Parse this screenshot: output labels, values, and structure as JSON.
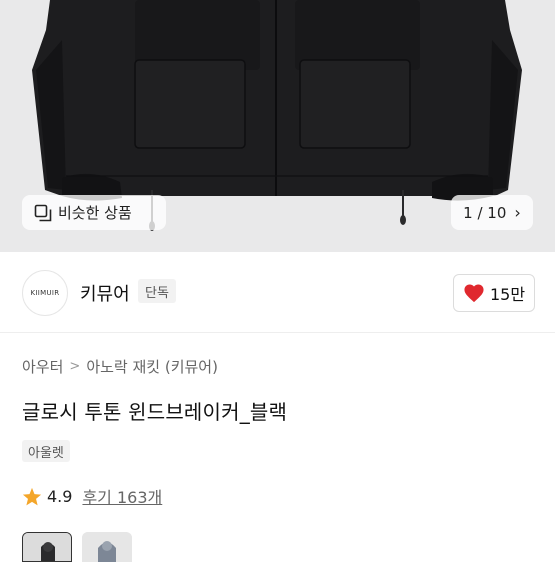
{
  "hero": {
    "similar_products_label": "비슷한 상품",
    "image_counter": "1 / 10"
  },
  "brand": {
    "logo_text": "KIIMUIR",
    "name": "키뮤어",
    "exclusive_tag": "단독",
    "likes": "15만"
  },
  "breadcrumb": {
    "category": "아우터",
    "subcategory": "아노락 재킷 (키뮤어)"
  },
  "product": {
    "title": "글로시 투톤 윈드브레이커_블랙",
    "tag": "아울렛",
    "rating": "4.9",
    "reviews": "후기 163개"
  },
  "colors": {
    "hero_bg": "#e9e9ea",
    "jacket": "#1d1d1f",
    "heart": "#e0282e",
    "star": "#f4a62a"
  }
}
